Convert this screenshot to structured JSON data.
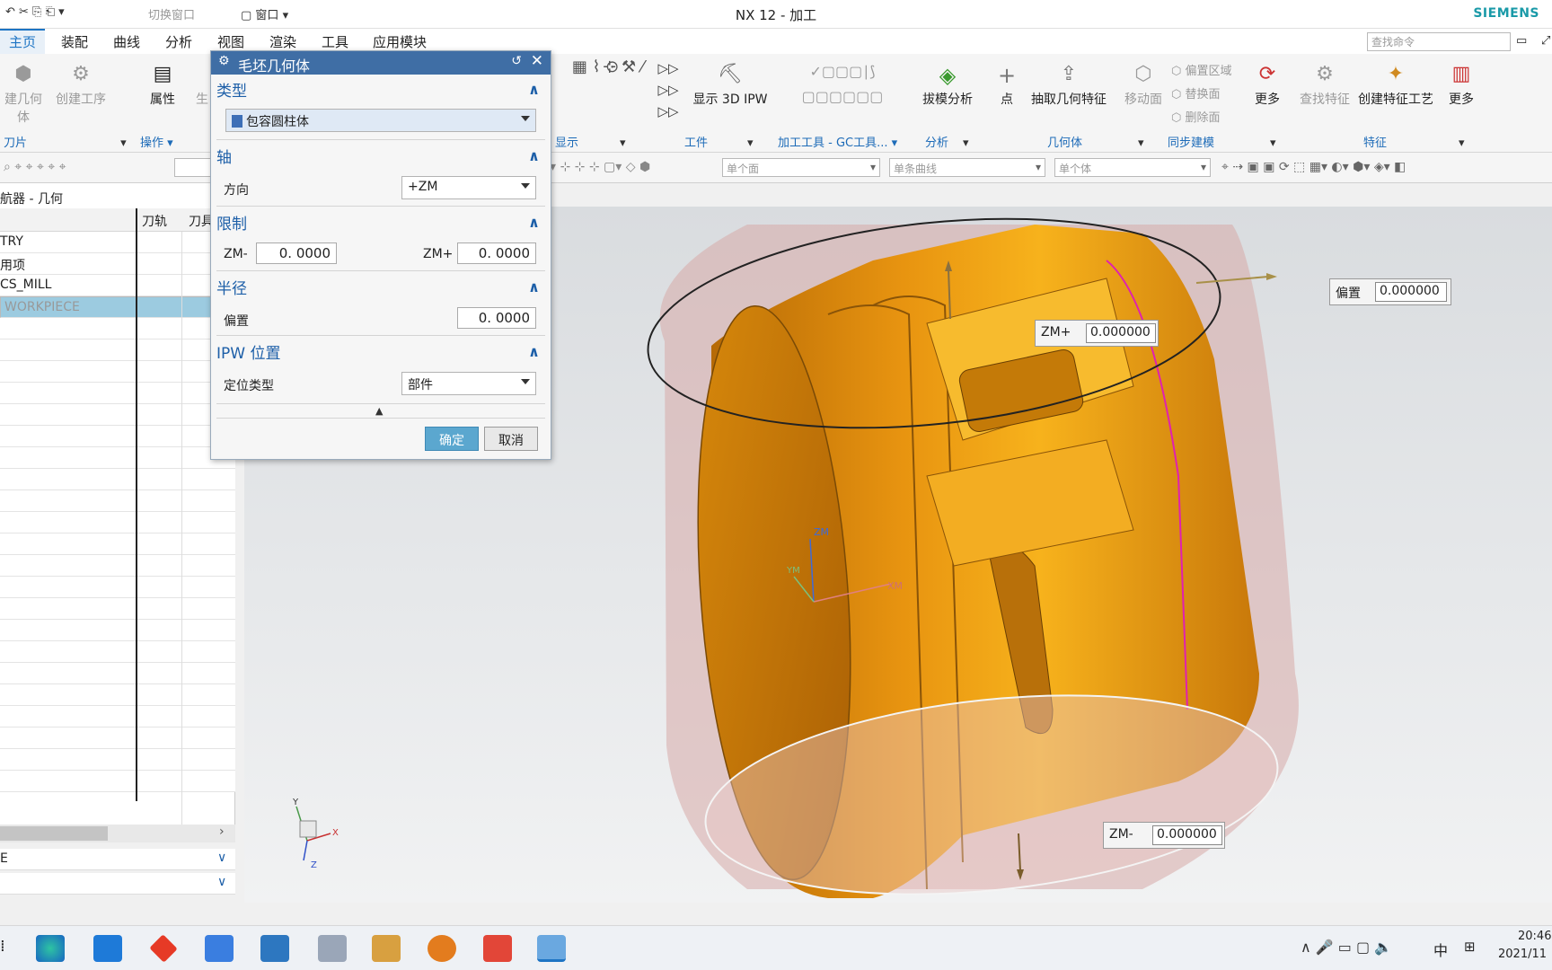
{
  "window": {
    "title": "NX 12 - 加工",
    "brand": "SIEMENS"
  },
  "quick_access": {
    "switch_window": "切换窗口",
    "window": "窗口"
  },
  "menu": [
    "主页",
    "装配",
    "曲线",
    "分析",
    "视图",
    "渲染",
    "工具",
    "应用模块"
  ],
  "search": {
    "placeholder": "查找命令"
  },
  "ribbon": {
    "create_geometry": "建几何体",
    "create_op": "创建工序",
    "properties": "属性",
    "gen": "生",
    "show_3d_ipw": "显示 3D IPW",
    "draft_analysis": "拔模分析",
    "point": "点",
    "extract_geometry": "抽取几何特征",
    "more1": "更多",
    "move_face": "移动面",
    "offset_region": "偏置区域",
    "replace_face": "替换面",
    "delete_face": "删除面",
    "more2": "更多",
    "find_feature": "查找特征",
    "create_feature_process": "创建特征工艺",
    "more3": "更多",
    "groups": {
      "tool": "刀片",
      "operation": "操作",
      "display": "显示",
      "workpiece": "工件",
      "machining_tools": "加工工具 - GC工具...",
      "analysis": "分析",
      "geometry": "几何体",
      "sync_modeling": "同步建模",
      "feature": "特征"
    }
  },
  "filters": {
    "face": "单个面",
    "curve": "单条曲线",
    "body": "单个体"
  },
  "navigator": {
    "title": "导航器 - 几何",
    "title_visible": "航器 - 几何",
    "columns": {
      "name": "",
      "path": "刀轨",
      "tool": "刀具"
    },
    "rows": [
      "GEOMETRY",
      "用项",
      "MCS_MILL",
      "WORKPIECE"
    ],
    "rows_visible": [
      "TRY",
      "用项",
      "CS_MILL",
      "WORKPIECE"
    ]
  },
  "dialog": {
    "title": "毛坯几何体",
    "type_section": "类型",
    "type_value": "包容圆柱体",
    "axis_section": "轴",
    "direction_label": "方向",
    "direction_value": "+ZM",
    "limits_section": "限制",
    "zm_minus_label": "ZM-",
    "zm_minus_value": "0. 0000",
    "zm_plus_label": "ZM+",
    "zm_plus_value": "0. 0000",
    "radius_section": "半径",
    "offset_label": "偏置",
    "offset_value": "0. 0000",
    "ipw_section": "IPW 位置",
    "position_type_label": "定位类型",
    "position_type_value": "部件",
    "ok": "确定",
    "cancel": "取消"
  },
  "viewport": {
    "offset_label": "偏置",
    "offset_value": "0.000000",
    "zmplus_label": "ZM+",
    "zmplus_value": "0.000000",
    "zmminus_label": "ZM-",
    "zmminus_value": "0.000000",
    "axis_z": "ZM",
    "axis_x": "XM",
    "axis_y": "YM",
    "triad_x": "X",
    "triad_y": "Y",
    "triad_z": "Z"
  },
  "taskbar": {
    "time": "20:46",
    "date": "2021/11",
    "ime": "中"
  },
  "colors": {
    "dialog_title": "#3f6ea5",
    "part": "#f5a414",
    "blank": "#d7a9a7",
    "accent": "#1d74c4",
    "selected_row": "#9ccbe0"
  }
}
